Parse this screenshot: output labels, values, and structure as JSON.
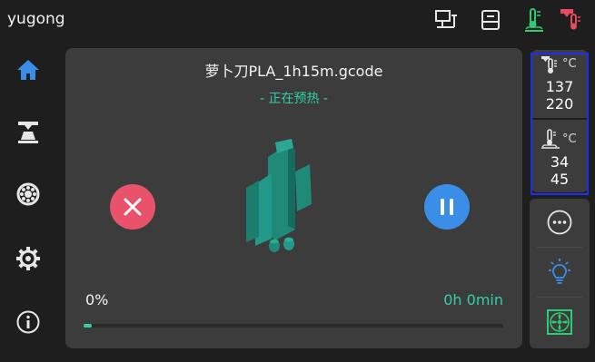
{
  "header": {
    "device_name": "yugong",
    "icons": [
      "network-icon",
      "printer-status-icon",
      "bed-heating-icon",
      "nozzle-heating-icon"
    ]
  },
  "sidebar": {
    "items": [
      {
        "name": "home",
        "icon": "home-icon"
      },
      {
        "name": "print",
        "icon": "printer-icon"
      },
      {
        "name": "filament",
        "icon": "filament-icon"
      },
      {
        "name": "settings",
        "icon": "gear-icon"
      },
      {
        "name": "about",
        "icon": "info-icon"
      }
    ]
  },
  "job": {
    "file_name": "萝卜刀PLA_1h15m.gcode",
    "status": "- 正在预热 -",
    "progress_label": "0%",
    "progress_fraction": 0.02,
    "time_left": "0h 0min"
  },
  "temps": {
    "nozzle": {
      "unit": "°C",
      "current": "137",
      "target": "220"
    },
    "bed": {
      "unit": "°C",
      "current": "34",
      "target": "45"
    }
  },
  "actions": [
    "more-icon",
    "light-icon",
    "fan-icon"
  ],
  "colors": {
    "background": "#1e1e1e",
    "panel": "#3c3c3c",
    "accent_green": "#2fd0a8",
    "cancel_red": "#e8526a",
    "pause_blue": "#3a8ee8",
    "nav_blue": "#3a8ee8",
    "highlight_border": "#1f2cf2",
    "model_teal": "#1f8a78"
  }
}
